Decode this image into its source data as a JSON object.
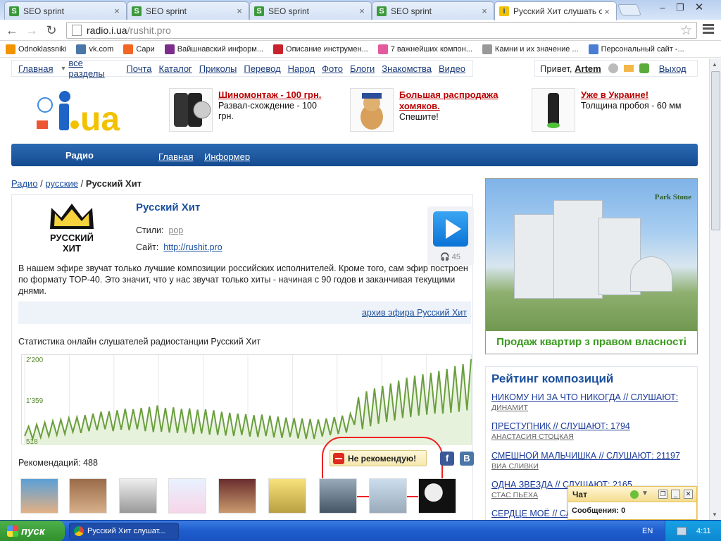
{
  "browser": {
    "tabs": [
      {
        "title": "SEO sprint",
        "icon": "seo-sprint-icon"
      },
      {
        "title": "SEO sprint",
        "icon": "seo-sprint-icon"
      },
      {
        "title": "SEO sprint",
        "icon": "seo-sprint-icon"
      },
      {
        "title": "SEO sprint",
        "icon": "seo-sprint-icon"
      },
      {
        "title": "Русский Хит слушать он",
        "icon": "iua-icon"
      }
    ],
    "url_host": "radio.i.ua",
    "url_path": "/rushit.pro",
    "bookmarks": [
      {
        "label": "Odnoklassniki",
        "icon": "ok-icon",
        "color": "#f29400"
      },
      {
        "label": "vk.com",
        "icon": "vk-icon",
        "color": "#4a76a8"
      },
      {
        "label": "Сари",
        "icon": "flame-icon",
        "color": "#f26522"
      },
      {
        "label": "Вайшнавский информ...",
        "icon": "vaishnava-icon",
        "color": "#7b2e8c"
      },
      {
        "label": "Описание инструмен...",
        "icon": "pinterest-icon",
        "color": "#c8232c"
      },
      {
        "label": "7 важнейших компон...",
        "icon": "sparkle-icon",
        "color": "#e45a9c"
      },
      {
        "label": "Камни и их значение ...",
        "icon": "page-icon",
        "color": "#999999"
      },
      {
        "label": "Персональный сайт -...",
        "icon": "drop-icon",
        "color": "#4a7dd4"
      }
    ]
  },
  "topnav": {
    "items": [
      "Главная",
      "все разделы",
      "Почта",
      "Каталог",
      "Приколы",
      "Перевод",
      "Народ",
      "Фото",
      "Блоги",
      "Знакомства",
      "Видео"
    ],
    "greeting": "Привет,",
    "user": "Artem",
    "logout": "Выход"
  },
  "ads": [
    {
      "title": "Шиномонтаж - 100 грн.",
      "text": "Развал-схождение - 100 грн."
    },
    {
      "title": "Большая распродажа хомяков.",
      "text": "Спешите!"
    },
    {
      "title": "Уже в Украине!",
      "text": "Толщина пробоя - 60 мм"
    }
  ],
  "bluenav": {
    "section": "Радио",
    "links": [
      "Главная",
      "Информер"
    ]
  },
  "breadcrumb": {
    "root": "Радио",
    "sep": "/",
    "cat": "русские",
    "current": "Русский Хит"
  },
  "station": {
    "title": "Русский Хит",
    "styles_label": "Стили:",
    "styles_value": "pop",
    "site_label": "Сайт:",
    "site_value": "http://rushit.pro",
    "listeners": "45",
    "description": "В нашем эфире звучат только лучшие композиции российских исполнителей. Кроме того, сам эфир построен по формату TOP-40. Это значит, что у нас звучат только хиты - начиная с 90 годов и заканчивая текущими днями.",
    "archive_link": "архив эфира Русский Хит",
    "logo_text_1": "РУССКИЙ",
    "logo_text_2": "ХИТ"
  },
  "stats": {
    "title": "Статистика онлайн слушателей радиостанции Русский Хит"
  },
  "chart_data": {
    "type": "area",
    "title": "",
    "ytick_labels": [
      "2'200",
      "1'359",
      "518"
    ],
    "ylim": [
      518,
      2200
    ],
    "series": [
      {
        "values": [
          620,
          820,
          560,
          860,
          590,
          900,
          610,
          930,
          640,
          960,
          660,
          990,
          700,
          1010,
          680,
          1050,
          720,
          1080,
          740,
          1120,
          760,
          1130,
          720,
          1150,
          750,
          1180,
          740,
          1170,
          760,
          1200,
          720,
          1220,
          700,
          1250,
          710,
          1200,
          690,
          1210,
          680,
          1180,
          690,
          1190,
          660,
          1160,
          670,
          1170,
          650,
          1150,
          640,
          1120,
          630,
          1100,
          620,
          1080,
          640,
          1070,
          610,
          1050,
          600,
          1060,
          620,
          1040,
          590,
          1020,
          580,
          1000,
          600,
          990,
          570,
          980,
          560,
          970,
          560,
          960,
          610,
          980,
          640,
          1010,
          660,
          1040,
          690,
          1080,
          850,
          1420,
          760,
          1540,
          820,
          1600,
          870,
          1650,
          910,
          1700,
          940,
          1760,
          990,
          1820,
          1010,
          1860,
          1040,
          1890,
          1060,
          1920,
          1080,
          1960,
          1080,
          2000,
          1100,
          2060,
          1120,
          2100,
          1150,
          2200
        ]
      }
    ]
  },
  "recommendations": {
    "label": "Рекомендаций:",
    "count": "488",
    "not_recommend": "Не рекомендую!"
  },
  "banner": {
    "caption": "Продаж квартир з правом власності",
    "brand": "Park Stone"
  },
  "rating": {
    "title": "Рейтинг композиций",
    "items": [
      {
        "song": "НИКОМУ НИ ЗА ЧТО НИКОГДА // СЛУШАЮТ:",
        "artist": "ДИНАМИТ"
      },
      {
        "song": "ПРЕСТУПНИК // СЛУШАЮТ: 1794",
        "artist": "АНАСТАСИЯ СТОЦКАЯ"
      },
      {
        "song": "СМЕШНОЙ МАЛЬЧИШКА // СЛУШАЮТ: 21197",
        "artist": "ВИА СЛИВКИ"
      },
      {
        "song": "ОДНА ЗВЕЗДА // СЛУШАЮТ: 2165",
        "artist": "СТАС ПЬЕХА"
      },
      {
        "song": "СЕРДЦЕ МОЁ // СЛУШАЮТ:",
        "artist": ""
      }
    ]
  },
  "chat": {
    "title": "Чат",
    "messages_label": "Сообщения: 0"
  },
  "taskbar": {
    "start": "пуск",
    "item": "Русский Хит слушат...",
    "lang": "EN",
    "time": "4:11"
  }
}
